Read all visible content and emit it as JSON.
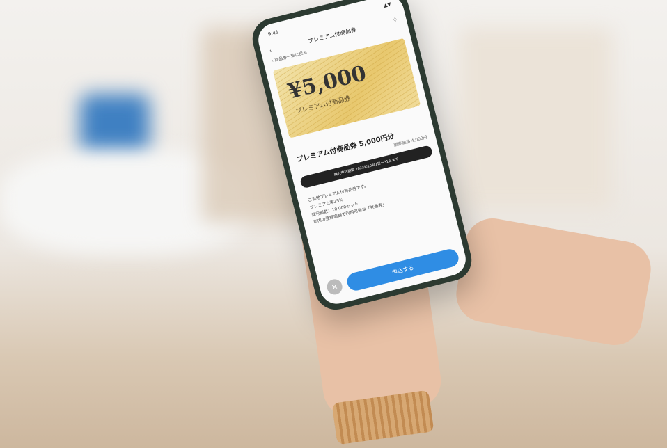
{
  "status": {
    "time": "9:41",
    "signal": "▲▼"
  },
  "nav": {
    "title": "プレミアム付商品券",
    "back": "‹",
    "bell": "♢"
  },
  "breadcrumb": {
    "link": "‹ 商品券一覧に戻る"
  },
  "voucher": {
    "amount": "¥5,000",
    "label": "プレミアム付商品券"
  },
  "product": {
    "title": "プレミアム付商品券 5,000円分",
    "price": "販売価格 4,000円"
  },
  "limit": {
    "text": "購入申込期間 2023年10月1日〜31日まで"
  },
  "description": {
    "line1": "ご当地プレミアム付商品券です。",
    "line2": "プレミアム率25%",
    "line3": "発行部数：10,000セット",
    "line4": "市内の登録店舗で利用可能な「共通券」"
  },
  "footer": {
    "close": "✕",
    "cta": "申込する"
  }
}
